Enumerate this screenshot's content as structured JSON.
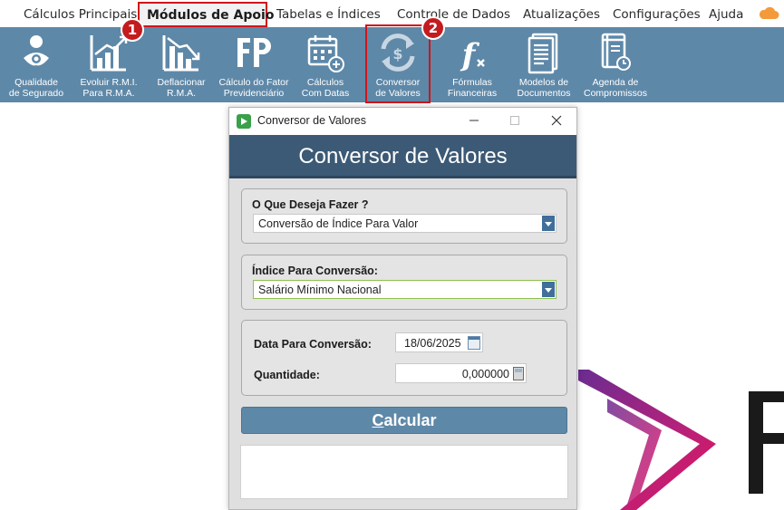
{
  "menubar": {
    "items": [
      "Cálculos Principais",
      "Módulos de Apoio",
      "Tabelas e Índices",
      "Controle de Dados",
      "Atualizações",
      "Configurações",
      "Ajuda"
    ],
    "cloud_icon": "cloud-icon"
  },
  "ribbon": {
    "items": [
      {
        "label": "Qualidade\nde Segurado",
        "icon": "insured-quality-icon"
      },
      {
        "label": "Evoluir R.M.I.\nPara R.M.A.",
        "icon": "growth-chart-icon"
      },
      {
        "label": "Deflacionar\nR.M.A.",
        "icon": "decline-chart-icon"
      },
      {
        "label": "Cálculo do Fator\nPrevidenciário",
        "icon": "fp-icon"
      },
      {
        "label": "Cálculos\nCom Datas",
        "icon": "calendar-icon"
      },
      {
        "label": "Conversor\nde Valores",
        "icon": "currency-convert-icon"
      },
      {
        "label": "Fórmulas\nFinanceiras",
        "icon": "formula-icon"
      },
      {
        "label": "Modelos de\nDocumentos",
        "icon": "document-icon"
      },
      {
        "label": "Agenda de\nCompromissos",
        "icon": "agenda-icon"
      }
    ],
    "accent": "#5e88a8"
  },
  "badges": [
    "1",
    "2"
  ],
  "dialog": {
    "window_title": "Conversor de Valores",
    "header": "Conversor de Valores",
    "what_to_do": {
      "label": "O Que Deseja Fazer ?",
      "value": "Conversão de Índice Para Valor"
    },
    "index": {
      "label": "Índice Para Conversão:",
      "value": "Salário Mínimo Nacional"
    },
    "date": {
      "label": "Data Para Conversão:",
      "value": "18/06/2025"
    },
    "quantity": {
      "label": "Quantidade:",
      "value": "0,000000"
    },
    "calc_button": {
      "first": "C",
      "rest": "alcular"
    }
  },
  "colors": {
    "highlight": "#d0141b",
    "header": "#3c5a75",
    "ribbon": "#5e88a8"
  }
}
